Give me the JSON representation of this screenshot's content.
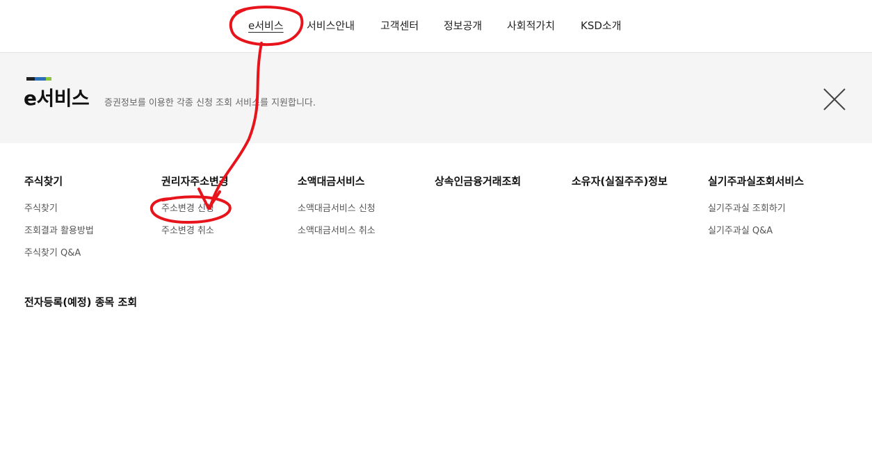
{
  "topnav": {
    "items": [
      {
        "label": "e서비스",
        "active": true
      },
      {
        "label": "서비스안내"
      },
      {
        "label": "고객센터"
      },
      {
        "label": "정보공개"
      },
      {
        "label": "사회적가치"
      },
      {
        "label": "KSD소개"
      }
    ]
  },
  "banner": {
    "title": "e서비스",
    "description": "증권정보를 이용한 각종 신청 조회 서비스를 지원합니다.",
    "bar_colors": [
      "#222222",
      "#2b6fb6",
      "#8cc63f"
    ],
    "close_icon": "close-icon"
  },
  "menu": {
    "columns": [
      {
        "title": "주식찾기",
        "items": [
          "주식찾기",
          "조회결과 활용방법",
          "주식찾기 Q&A"
        ]
      },
      {
        "title": "권리자주소변경",
        "items": [
          "주소변경 신청",
          "주소변경 취소"
        ]
      },
      {
        "title": "소액대금서비스",
        "items": [
          "소액대금서비스 신청",
          "소액대금서비스 취소"
        ]
      },
      {
        "title": "상속인금융거래조회",
        "items": []
      },
      {
        "title": "소유자(실질주주)정보",
        "items": []
      },
      {
        "title": "실기주과실조회서비스",
        "items": [
          "실기주과실 조회하기",
          "실기주과실 Q&A"
        ]
      }
    ],
    "extra_title": "전자등록(예정) 종목 조회"
  },
  "annotation_color": "#e8141c"
}
